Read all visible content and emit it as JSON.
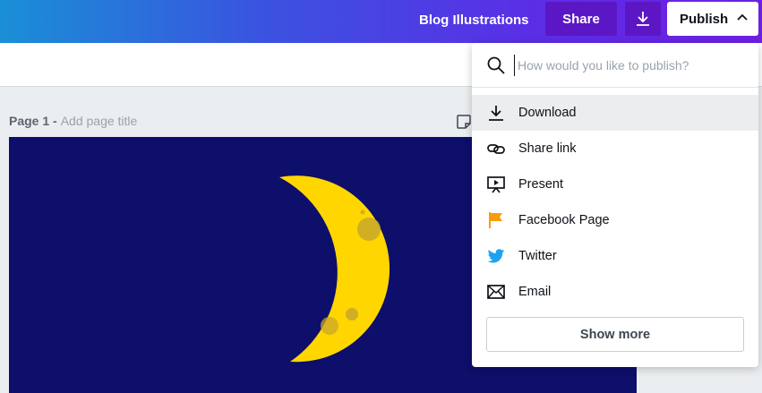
{
  "header": {
    "doc_title": "Blog Illustrations",
    "share_label": "Share",
    "publish_label": "Publish"
  },
  "page": {
    "label": "Page 1 -",
    "add_title": "Add page title"
  },
  "publish_menu": {
    "search_placeholder": "How would you like to publish?",
    "items": [
      {
        "label": "Download",
        "icon": "download-icon"
      },
      {
        "label": "Share link",
        "icon": "link-icon"
      },
      {
        "label": "Present",
        "icon": "present-icon"
      },
      {
        "label": "Facebook Page",
        "icon": "facebook-flag-icon"
      },
      {
        "label": "Twitter",
        "icon": "twitter-icon"
      },
      {
        "label": "Email",
        "icon": "email-icon"
      }
    ],
    "show_more_label": "Show more"
  },
  "colors": {
    "canvas_bg": "#0e0e6b",
    "moon": "#ffd600",
    "flag": "#f59e0b",
    "twitter": "#1da1f2"
  }
}
